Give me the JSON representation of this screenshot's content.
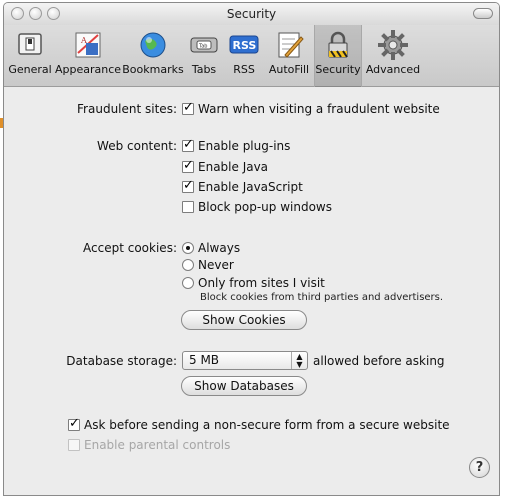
{
  "window": {
    "title": "Security"
  },
  "toolbar": {
    "items": [
      {
        "label": "General",
        "icon": "general-switch-icon"
      },
      {
        "label": "Appearance",
        "icon": "appearance-icon"
      },
      {
        "label": "Bookmarks",
        "icon": "bookmarks-globe-icon"
      },
      {
        "label": "Tabs",
        "icon": "tabs-icon"
      },
      {
        "label": "RSS",
        "icon": "rss-icon"
      },
      {
        "label": "AutoFill",
        "icon": "autofill-icon"
      },
      {
        "label": "Security",
        "icon": "lock-icon",
        "active": true
      },
      {
        "label": "Advanced",
        "icon": "gear-icon"
      }
    ]
  },
  "fraud": {
    "label": "Fraudulent sites:",
    "option": "Warn when visiting a fraudulent website",
    "checked": true
  },
  "web_content": {
    "label": "Web content:",
    "options": [
      {
        "text": "Enable plug-ins",
        "checked": true
      },
      {
        "text": "Enable Java",
        "checked": true
      },
      {
        "text": "Enable JavaScript",
        "checked": true
      },
      {
        "text": "Block pop-up windows",
        "checked": false
      }
    ]
  },
  "cookies": {
    "label": "Accept cookies:",
    "options": [
      {
        "text": "Always",
        "selected": true
      },
      {
        "text": "Never",
        "selected": false
      },
      {
        "text": "Only from sites I visit",
        "selected": false
      }
    ],
    "note": "Block cookies from third parties and advertisers.",
    "show_button": "Show Cookies"
  },
  "database": {
    "label": "Database storage:",
    "selected": "5 MB",
    "suffix": "allowed before asking",
    "show_button": "Show Databases"
  },
  "bottom": {
    "ask_nonsecure": "Ask before sending a non-secure form from a secure website",
    "ask_checked": true,
    "parental": "Enable parental controls",
    "parental_checked": false,
    "parental_disabled": true
  },
  "help_label": "?"
}
